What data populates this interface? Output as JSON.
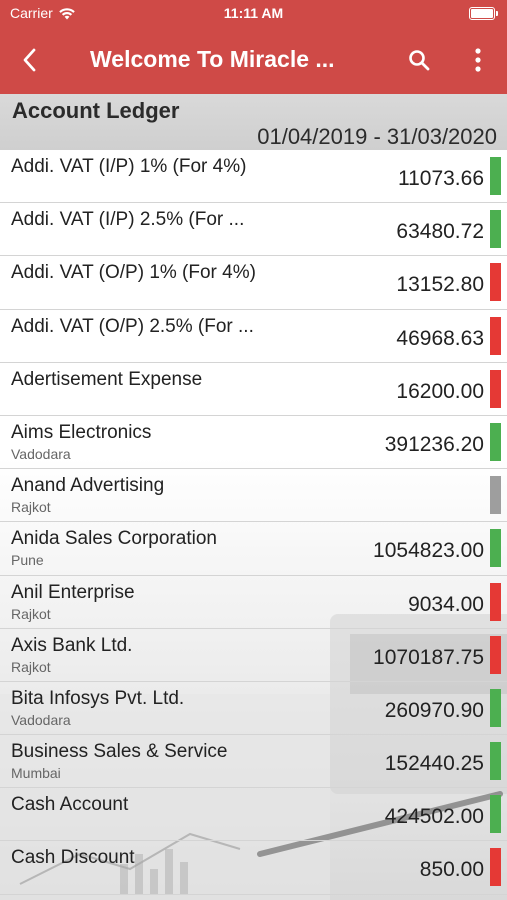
{
  "status_bar": {
    "carrier": "Carrier",
    "time": "11:11 AM"
  },
  "app_bar": {
    "title": "Welcome To Miracle ...",
    "icons": [
      "back-arrow-icon",
      "search-icon",
      "more-vertical-icon"
    ]
  },
  "ledger": {
    "title": "Account Ledger",
    "date_range": "01/04/2019 - 31/03/2020"
  },
  "colors": {
    "brand": "#cf4a47",
    "credit": "#4caf50",
    "debit": "#e53935",
    "neutral": "#9e9e9e"
  },
  "accounts": [
    {
      "name": "Addi. VAT (I/P) 1% (For 4%)",
      "city": "",
      "amount": "11073.66",
      "status": "credit"
    },
    {
      "name": "Addi. VAT (I/P) 2.5% (For ...",
      "city": "",
      "amount": "63480.72",
      "status": "credit"
    },
    {
      "name": "Addi. VAT (O/P) 1% (For 4%)",
      "city": "",
      "amount": "13152.80",
      "status": "debit"
    },
    {
      "name": "Addi. VAT (O/P) 2.5% (For ...",
      "city": "",
      "amount": "46968.63",
      "status": "debit"
    },
    {
      "name": "Adertisement Expense",
      "city": "",
      "amount": "16200.00",
      "status": "debit"
    },
    {
      "name": "Aims Electronics",
      "city": "Vadodara",
      "amount": "391236.20",
      "status": "credit"
    },
    {
      "name": "Anand Advertising",
      "city": "Rajkot",
      "amount": "",
      "status": "neutral"
    },
    {
      "name": "Anida Sales Corporation",
      "city": "Pune",
      "amount": "1054823.00",
      "status": "credit"
    },
    {
      "name": "Anil Enterprise",
      "city": "Rajkot",
      "amount": "9034.00",
      "status": "debit"
    },
    {
      "name": "Axis Bank Ltd.",
      "city": "Rajkot",
      "amount": "1070187.75",
      "status": "debit"
    },
    {
      "name": "Bita Infosys Pvt. Ltd.",
      "city": "Vadodara",
      "amount": "260970.90",
      "status": "credit"
    },
    {
      "name": "Business Sales & Service",
      "city": "Mumbai",
      "amount": "152440.25",
      "status": "credit"
    },
    {
      "name": "Cash Account",
      "city": "",
      "amount": "424502.00",
      "status": "credit"
    },
    {
      "name": "Cash Discount",
      "city": "",
      "amount": "850.00",
      "status": "debit"
    }
  ]
}
